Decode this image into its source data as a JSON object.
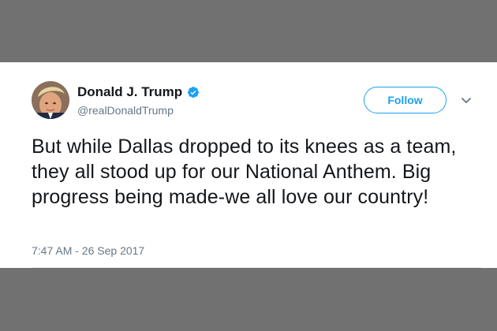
{
  "tweet": {
    "author": {
      "display_name": "Donald J. Trump",
      "handle": "@realDonaldTrump",
      "avatar_icon": "profile-photo",
      "verified_icon": "verified-badge-icon",
      "verified_color": "#1da1f2"
    },
    "follow_label": "Follow",
    "menu_icon": "chevron-down-icon",
    "text": "But while Dallas dropped to its knees as a team, they all stood up for our National Anthem. Big progress being made-we all love our country!",
    "timestamp": "7:47 AM - 26 Sep 2017"
  },
  "colors": {
    "backdrop": "#717171",
    "card": "#ffffff",
    "accent": "#1da1f2",
    "text_primary": "#14171a",
    "text_secondary": "#657786"
  }
}
